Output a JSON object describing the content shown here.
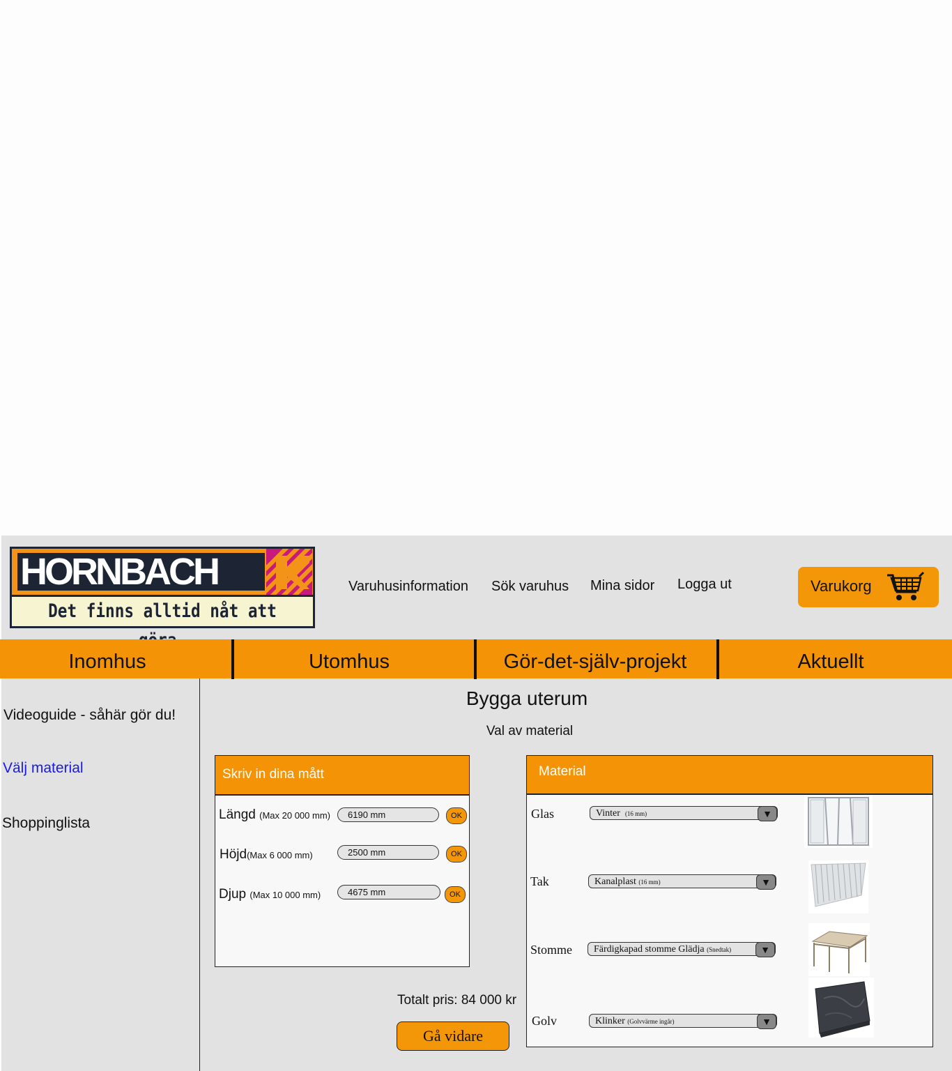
{
  "header": {
    "logo": {
      "word": "HORNBACH",
      "slogan": "Det finns alltid nåt att göra."
    },
    "links": [
      "Varuhusinformation",
      "Sök varuhus",
      "Mina sidor",
      "Logga ut"
    ],
    "cart_label": "Varukorg"
  },
  "nav": [
    "Inomhus",
    "Utomhus",
    "Gör-det-själv-projekt",
    "Aktuellt"
  ],
  "sidebar": {
    "items": [
      {
        "label": "Videoguide - såhär gör du!",
        "active": false
      },
      {
        "label": "Välj material",
        "active": true
      },
      {
        "label": "Shoppinglista",
        "active": false
      }
    ]
  },
  "main": {
    "title": "Bygga uterum",
    "subtitle": "Val av material",
    "dimensions": {
      "header": "Skriv in dina mått",
      "ok_label": "OK",
      "rows": [
        {
          "label": "Längd",
          "hint": "(Max 20 000 mm)",
          "value": "6190 mm"
        },
        {
          "label": "Höjd",
          "hint": "(Max 6 000 mm)",
          "value": "2500 mm"
        },
        {
          "label": "Djup",
          "hint": "(Max 10 000 mm)",
          "value": "4675 mm"
        }
      ]
    },
    "material": {
      "header": "Material",
      "rows": [
        {
          "label": "Glas",
          "value": "Vinter",
          "note": "(16 mm)"
        },
        {
          "label": "Tak",
          "value": "Kanalplast",
          "note": "(16 mm)"
        },
        {
          "label": "Stomme",
          "value": "Färdigkapad stomme Glädja",
          "note": "(Snedtak)"
        },
        {
          "label": "Golv",
          "value": "Klinker",
          "note": "(Golvvärme ingår)"
        }
      ]
    },
    "total": "Totalt pris: 84 000 kr",
    "continue_label": "Gå vidare"
  },
  "colors": {
    "accent": "#f39305",
    "background": "#e2e2e2",
    "active_link": "#1a1ae6"
  },
  "icons": [
    "shopping-cart-icon",
    "dropdown-arrow-icon",
    "hornbach-logo-mark"
  ]
}
